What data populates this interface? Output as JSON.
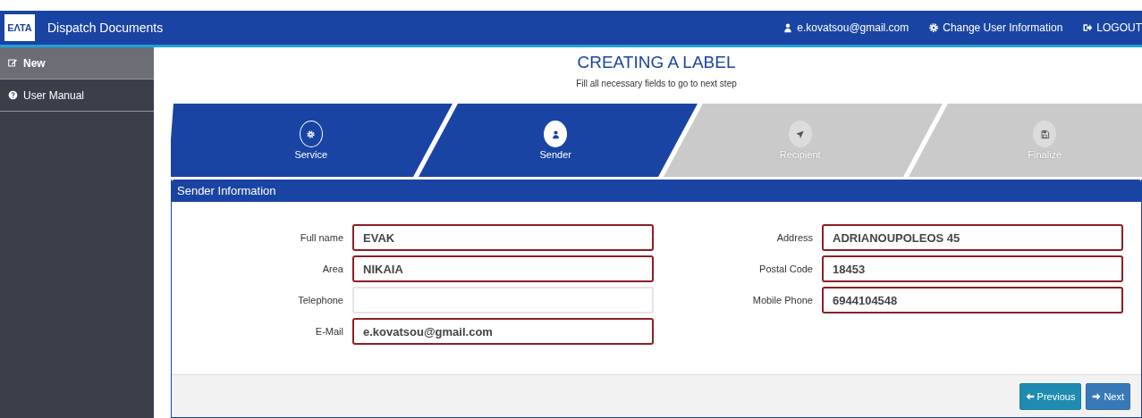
{
  "header": {
    "logo": {
      "text": "ΕΛΤΑ"
    },
    "title": "Dispatch Documents",
    "user": "e.kovatsou@gmail.com",
    "change_info": "Change User Information",
    "logout": "LOGOUT"
  },
  "sidebar": {
    "items": [
      {
        "label": "New",
        "selected": true
      },
      {
        "label": "User Manual",
        "selected": false
      }
    ]
  },
  "page": {
    "title": "CREATING A LABEL",
    "subtitle": "Fill all necessary fields to go to next step"
  },
  "steps": [
    {
      "label": "Service",
      "completed": true,
      "selected": false
    },
    {
      "label": "Sender",
      "completed": true,
      "selected": true
    },
    {
      "label": "Recipient",
      "completed": false,
      "selected": false
    },
    {
      "label": "Finalize",
      "completed": false,
      "selected": false
    }
  ],
  "panel": {
    "title": "Sender Information",
    "left_fields": [
      {
        "label": "Full name",
        "value": "EVAK",
        "invalid": true
      },
      {
        "label": "Area",
        "value": "NIKAIA",
        "invalid": true
      },
      {
        "label": "Telephone",
        "invalid": false
      },
      {
        "label": "E-Mail",
        "value": "e.kovatsou@gmail.com",
        "invalid": true
      }
    ],
    "right_fields": [
      {
        "label": "Address",
        "value": "ADRIANOUPOLEOS 45",
        "invalid": true
      },
      {
        "label": "Postal Code",
        "value": "18453",
        "invalid": true
      },
      {
        "label": "Mobile Phone",
        "value": "6944104548",
        "invalid": true
      }
    ]
  },
  "buttons": [
    {
      "label": "Previous",
      "kind": "previous"
    },
    {
      "label": "Next",
      "kind": "next"
    }
  ]
}
